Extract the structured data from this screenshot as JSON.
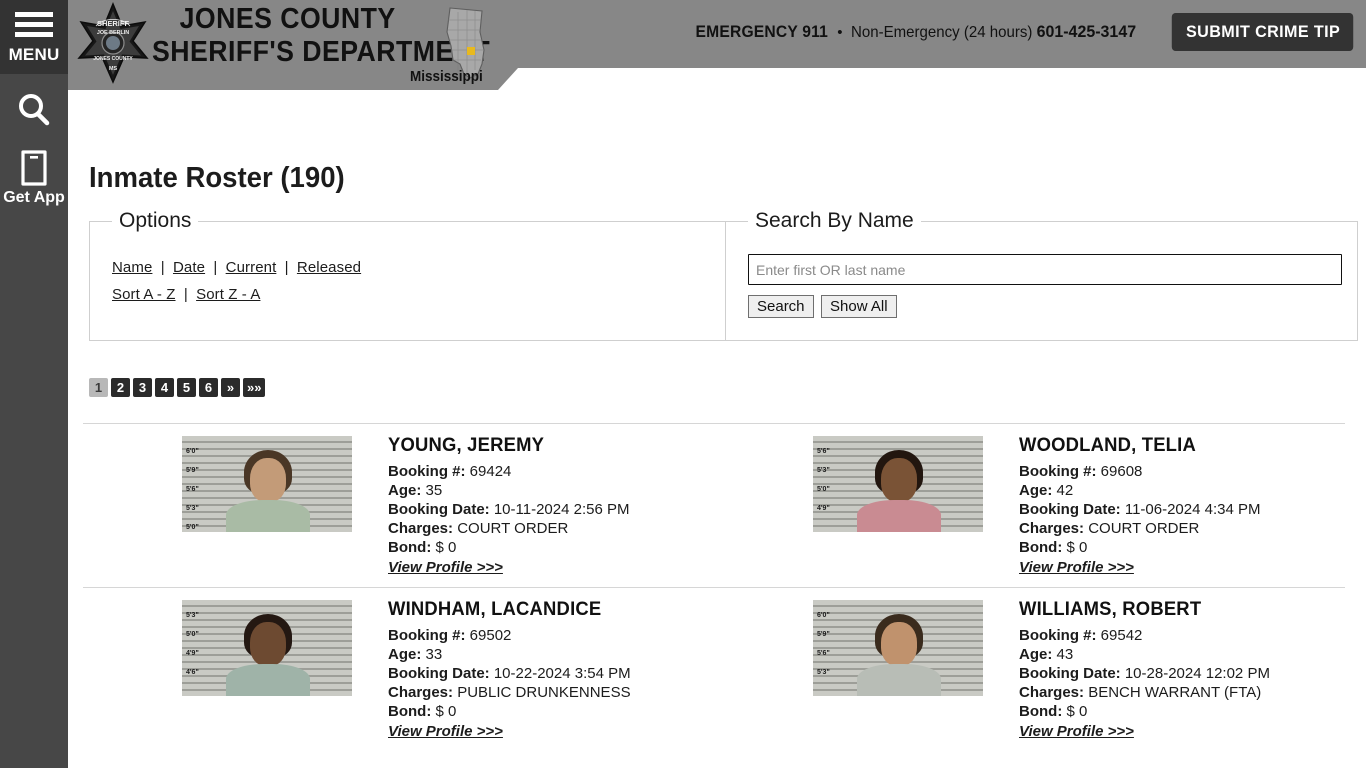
{
  "rail": {
    "menu_label": "MENU",
    "search_icon": "search-icon",
    "getapp_label": "Get App",
    "getapp_icon": "mobile-phone-icon"
  },
  "header": {
    "badge_icon": "sheriff-star-badge-icon",
    "badge_text_top": "SHERIFF",
    "badge_text_mid": "JOE BERLIN",
    "badge_text_low": "JONES COUNTY",
    "badge_text_bottom": "MS",
    "title_line1": "JONES COUNTY",
    "title_line2": "SHERIFF'S DEPARTMENT",
    "map_icon": "mississippi-state-map-icon",
    "map_label": "Mississippi",
    "emergency": "EMERGENCY 911",
    "separator": "•",
    "non_emergency_label": "Non-Emergency (24 hours)",
    "non_emergency_phone": "601-425-3147",
    "crime_tip_button": "SUBMIT CRIME TIP",
    "bg_color": "#878787",
    "button_color": "#333333"
  },
  "main": {
    "page_title": "Inmate Roster (190)",
    "options": {
      "legend": "Options",
      "filters": [
        "Name",
        "Date",
        "Current",
        "Released"
      ],
      "sorts": [
        "Sort A - Z",
        "Sort Z - A"
      ],
      "separator": "|"
    },
    "search": {
      "legend": "Search By Name",
      "placeholder": "Enter first OR last name",
      "value": "",
      "search_button": "Search",
      "show_all_button": "Show All"
    },
    "pagination": {
      "pages": [
        "1",
        "2",
        "3",
        "4",
        "5",
        "6"
      ],
      "next_label": "»",
      "last_label": "»»",
      "active": "1",
      "active_bg": "#b8b8b8",
      "inactive_bg": "#2b2b2b"
    },
    "labels": {
      "booking": "Booking #:",
      "age": "Age:",
      "booking_date": "Booking Date:",
      "charges": "Charges:",
      "bond": "Bond:",
      "view_profile": "View Profile >>>"
    },
    "inmates": [
      {
        "name": "YOUNG, JEREMY",
        "booking": "69424",
        "age": "35",
        "booking_date": "10-11-2024 2:56 PM",
        "charges": "COURT ORDER",
        "bond": "$ 0",
        "photo": "mugshot-photo",
        "skin": "#c39b78",
        "hair": "#4a3726",
        "shirt": "#a9bba5",
        "ticks": [
          "6'0\"",
          "5'9\"",
          "5'6\"",
          "5'3\"",
          "5'0\""
        ]
      },
      {
        "name": "WOODLAND, TELIA",
        "booking": "69608",
        "age": "42",
        "booking_date": "11-06-2024 4:34 PM",
        "charges": "COURT ORDER",
        "bond": "$ 0",
        "photo": "mugshot-photo",
        "skin": "#7a5336",
        "hair": "#22160f",
        "shirt": "#c98b92",
        "ticks": [
          "5'6\"",
          "5'3\"",
          "5'0\"",
          "4'9\""
        ]
      },
      {
        "name": "WINDHAM, LACANDICE",
        "booking": "69502",
        "age": "33",
        "booking_date": "10-22-2024 3:54 PM",
        "charges": "PUBLIC DRUNKENNESS",
        "bond": "$ 0",
        "photo": "mugshot-photo",
        "skin": "#6d4a31",
        "hair": "#241812",
        "shirt": "#9fb3a8",
        "ticks": [
          "5'3\"",
          "5'0\"",
          "4'9\"",
          "4'6\""
        ]
      },
      {
        "name": "WILLIAMS, ROBERT",
        "booking": "69542",
        "age": "43",
        "booking_date": "10-28-2024 12:02 PM",
        "charges": "BENCH WARRANT (FTA)",
        "bond": "$ 0",
        "photo": "mugshot-photo",
        "skin": "#c0926d",
        "hair": "#3a2b1d",
        "shirt": "#b8bdb6",
        "ticks": [
          "6'0\"",
          "5'9\"",
          "5'6\"",
          "5'3\""
        ]
      }
    ]
  }
}
